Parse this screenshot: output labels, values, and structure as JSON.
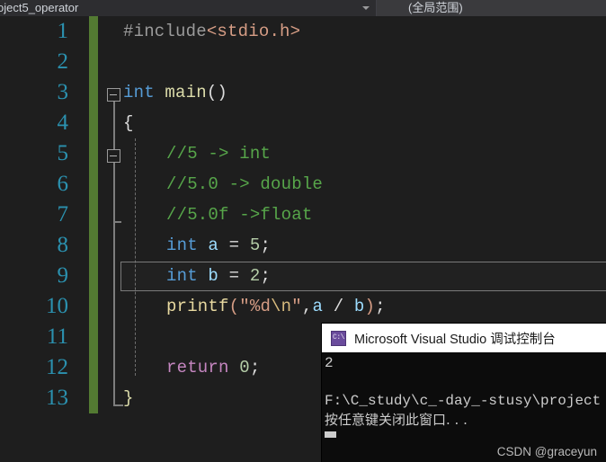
{
  "nav": {
    "member_dropdown_value": "oject5_operator",
    "scope_dropdown_value": "(全局范围)",
    "arrow_icon": "chevron-down-icon"
  },
  "editor": {
    "lines": [
      {
        "num": "1",
        "text": "#include<stdio.h>"
      },
      {
        "num": "2",
        "text": ""
      },
      {
        "num": "3",
        "text": "int main()"
      },
      {
        "num": "4",
        "text": "{"
      },
      {
        "num": "5",
        "text": "//5 -> int"
      },
      {
        "num": "6",
        "text": "//5.0 -> double"
      },
      {
        "num": "7",
        "text": "//5.0f ->float"
      },
      {
        "num": "8",
        "text": "int a = 5;"
      },
      {
        "num": "9",
        "text": "int b = 2;"
      },
      {
        "num": "10",
        "text": "printf(\"%d\\n\",a / b);"
      },
      {
        "num": "11",
        "text": ""
      },
      {
        "num": "12",
        "text": "return 0;"
      },
      {
        "num": "13",
        "text": "}"
      }
    ],
    "tokens": {
      "l1_include": "#include",
      "l1_header": "<stdio.h>",
      "l3_kw": "int",
      "l3_fn": " main",
      "l3_parens": "()",
      "l4_brace": "{",
      "l5_comment": "//5 -> int",
      "l6_comment": "//5.0 -> double",
      "l7_comment": "//5.0f ->float",
      "l8_kw": "int",
      "l8_var": " a ",
      "l8_eq": "= ",
      "l8_num": "5",
      "l8_semi": ";",
      "l9_kw": "int",
      "l9_var": " b ",
      "l9_eq": "= ",
      "l9_num": "2",
      "l9_semi": ";",
      "l10_fn": "printf",
      "l10_open": "(",
      "l10_str_a": "\"%d",
      "l10_esc": "\\n",
      "l10_str_b": "\"",
      "l10_comma": ",",
      "l10_a": "a",
      "l10_op": " / ",
      "l10_b": "b",
      "l10_close": ")",
      "l10_semi": ";",
      "l12_kw": "return",
      "l12_num": " 0",
      "l12_semi": ";",
      "l13_brace": "}"
    },
    "colors": {
      "background": "#1e1e1e",
      "line_number": "#2b91af",
      "change_bar": "#537a32",
      "comment": "#57a64a",
      "keyword": "#569cd6",
      "string": "#d69d85",
      "number": "#b5cea8",
      "identifier": "#9cdcfe",
      "function": "#e8d9a0",
      "return_keyword": "#c586c0"
    },
    "fold_markers": [
      "line-3-collapse",
      "line-5-collapse"
    ],
    "current_line": "9"
  },
  "console": {
    "title": "Microsoft Visual Studio 调试控制台",
    "icon": "console-cmd-icon",
    "icon_label": "C:\\",
    "output": [
      "2",
      "",
      "F:\\C_study\\c_-day_-stusy\\project",
      "按任意键关闭此窗口. . ."
    ],
    "cursor": "block-cursor"
  },
  "watermark": {
    "text": "CSDN @graceyun"
  }
}
